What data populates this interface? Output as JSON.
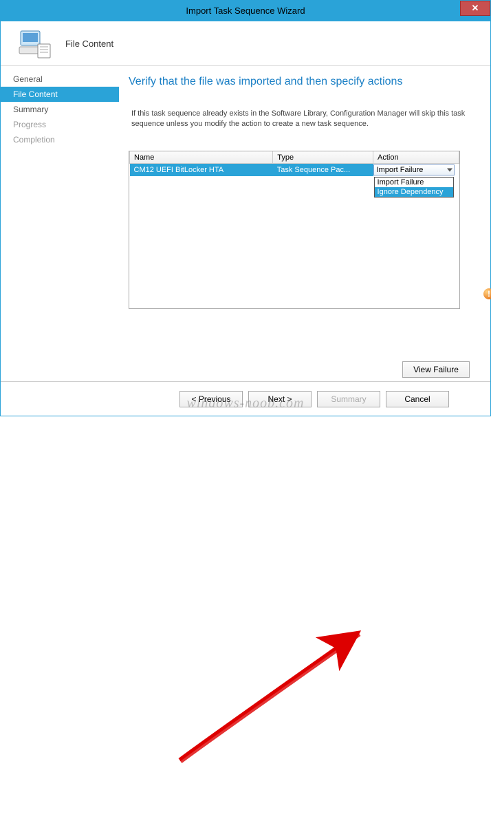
{
  "window": {
    "title": "Import Task Sequence Wizard"
  },
  "banner": {
    "heading": "File Content"
  },
  "steps": {
    "general": "General",
    "file_content": "File Content",
    "summary": "Summary",
    "progress": "Progress",
    "completion": "Completion"
  },
  "main": {
    "heading": "Verify that the file was imported and then specify actions",
    "note": "If this task sequence already exists in the Software Library, Configuration Manager will skip this task sequence unless you modify the action to create a new task sequence."
  },
  "table": {
    "headers": {
      "name": "Name",
      "type": "Type",
      "action": "Action"
    },
    "row": {
      "name": "CM12 UEFI BitLocker HTA",
      "type": "Task Sequence Pac...",
      "action_selected": "Import Failure",
      "action_options": {
        "opt1": "Import Failure",
        "opt2": "Ignore Dependency"
      }
    }
  },
  "buttons": {
    "view_failure": "View Failure",
    "previous": "< Previous",
    "next": "Next >",
    "summary": "Summary",
    "cancel": "Cancel"
  },
  "watermark": "windows-noob.com"
}
